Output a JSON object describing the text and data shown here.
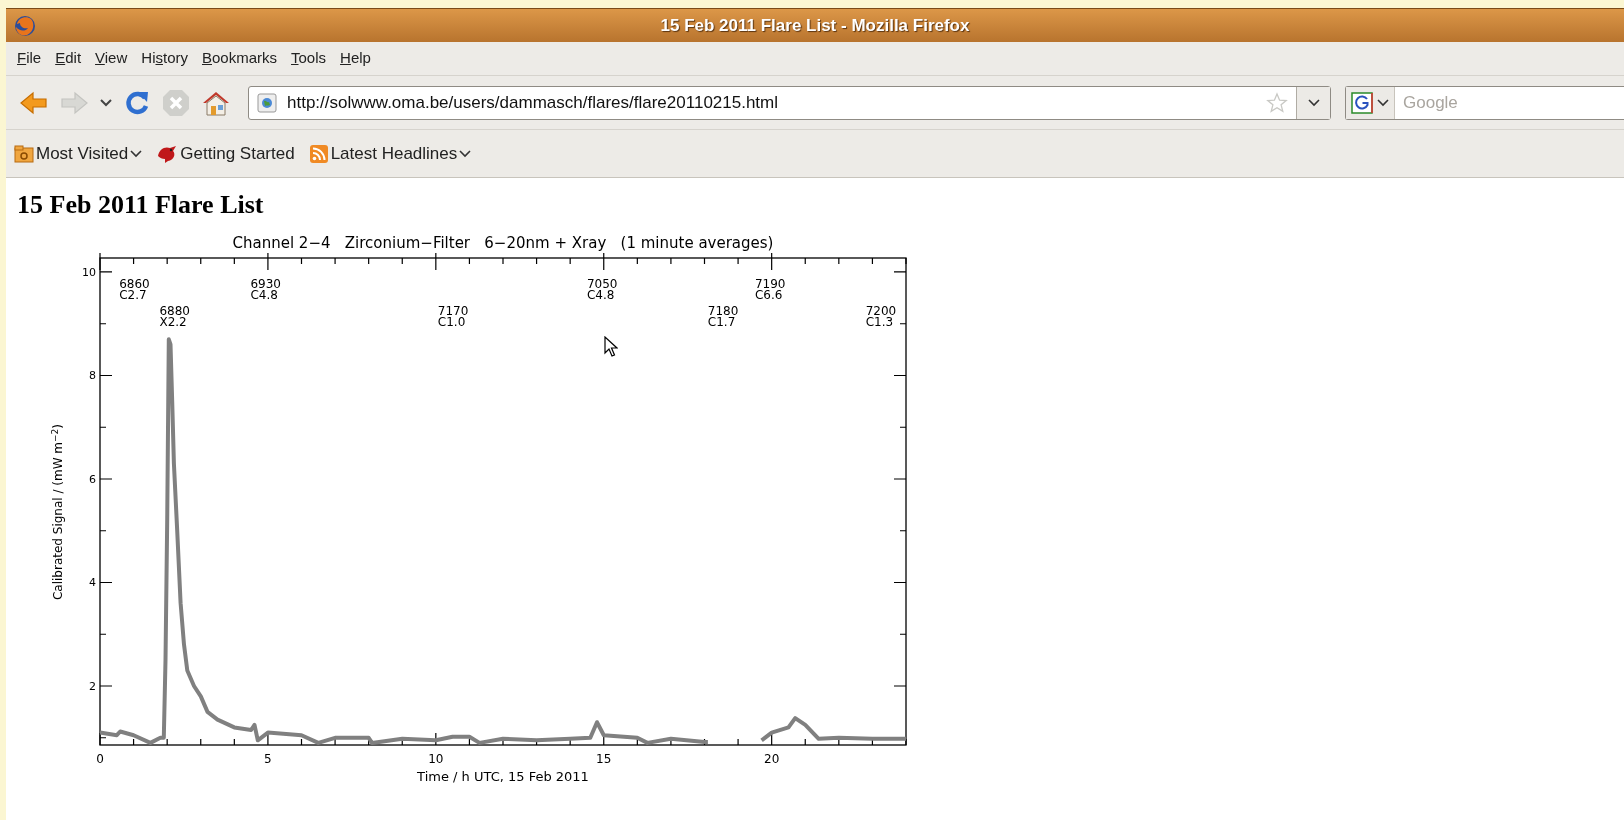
{
  "window": {
    "title": "15 Feb 2011 Flare List - Mozilla Firefox"
  },
  "menu": [
    {
      "access_key": "F",
      "rest": "ile"
    },
    {
      "access_key": "E",
      "rest": "dit"
    },
    {
      "access_key": "V",
      "rest": "iew"
    },
    {
      "start": "Hi",
      "access_key": "s",
      "rest": "tory"
    },
    {
      "access_key": "B",
      "rest": "ookmarks"
    },
    {
      "access_key": "T",
      "rest": "ools"
    },
    {
      "access_key": "H",
      "rest": "elp"
    }
  ],
  "navigation": [
    {
      "kind": "back",
      "disabled": false
    },
    {
      "kind": "forward",
      "disabled": true
    },
    {
      "kind": "history",
      "disabled": false
    },
    {
      "kind": "reload",
      "disabled": false
    },
    {
      "kind": "stop",
      "disabled": true
    },
    {
      "kind": "home",
      "disabled": false
    }
  ],
  "address_bar": {
    "value": "http://solwww.oma.be/users/dammasch/flares/flare20110215.html"
  },
  "search": {
    "placeholder": "Google"
  },
  "bookmarks": [
    {
      "label": "Most Visited",
      "kind": "folder",
      "dropdown": true
    },
    {
      "label": "Getting Started",
      "kind": "page",
      "dropdown": false
    },
    {
      "label": "Latest Headlines",
      "kind": "feed",
      "dropdown": true
    }
  ],
  "page": {
    "heading": "15 Feb 2011 Flare List",
    "chart_data": {
      "type": "line",
      "title": "Channel 2−4   Zirconium−Filter   6−20nm + Xray   (1 minute averages)",
      "xlabel": "Time / h UTC, 15 Feb 2011",
      "ylabel": "Calibrated Signal / (mW m$^{−2}$)",
      "x": [
        0,
        0.5,
        0.6,
        1,
        1.5,
        1.8,
        1.9,
        1.95,
        2,
        2.05,
        2.1,
        2.15,
        2.2,
        2.3,
        2.4,
        2.5,
        2.6,
        2.8,
        3,
        3.2,
        3.5,
        4,
        4.5,
        4.6,
        4.7,
        5,
        6,
        6.5,
        7,
        8,
        8.1,
        9,
        10,
        10.5,
        11,
        11.3,
        12,
        13,
        14,
        14.6,
        14.8,
        15,
        16,
        16.3,
        17,
        18,
        18.1,
        19.7,
        20,
        20.5,
        20.7,
        21,
        21.4,
        22,
        23,
        24
      ],
      "series": [
        {
          "color": "#808080",
          "values": [
            1.1,
            1.05,
            1.12,
            1.05,
            0.9,
            1.0,
            1.0,
            2.5,
            5.2,
            8.7,
            8.6,
            7.5,
            6.3,
            5.0,
            3.6,
            2.8,
            2.3,
            2.0,
            1.8,
            1.5,
            1.35,
            1.2,
            1.15,
            1.25,
            0.95,
            1.1,
            1.05,
            0.9,
            1.0,
            1.0,
            0.9,
            0.98,
            0.95,
            1.02,
            1.02,
            0.9,
            0.98,
            0.95,
            0.98,
            1.0,
            1.3,
            1.05,
            1.0,
            0.9,
            0.98,
            0.92,
            null,
            0.95,
            1.1,
            1.2,
            1.38,
            1.25,
            0.98,
            1.0,
            0.98,
            0.98
          ]
        }
      ],
      "xlim": [
        0,
        24
      ],
      "ylim": [
        0.86,
        10.27
      ],
      "xticks": [
        0,
        5,
        10,
        15,
        20
      ],
      "yticks": [
        2,
        4,
        6,
        8,
        10
      ],
      "annotations": [
        "6860\nC2.7",
        "6930\nC4.8",
        "7050\nC4.8",
        "7190\nC6.6",
        "6880\nX2.2",
        "7170\nC1.0",
        "7180\nC1.7",
        "7200\nC1.3"
      ]
    }
  }
}
